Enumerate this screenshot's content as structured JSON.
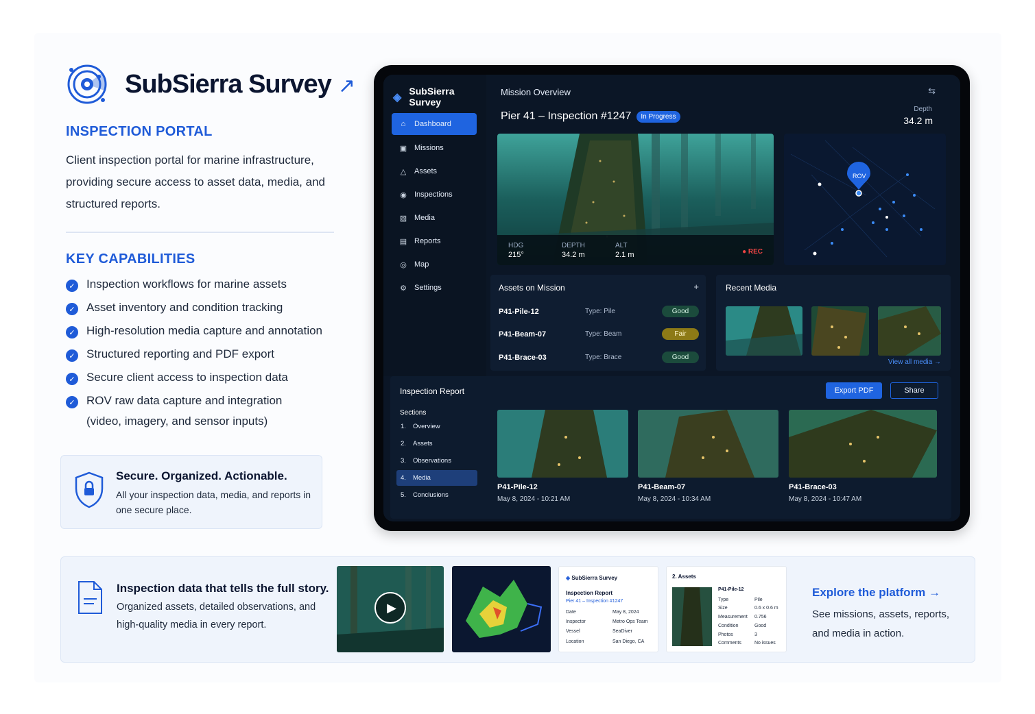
{
  "brand": {
    "name": "SubSierra Survey",
    "arrow": "↗"
  },
  "portal": {
    "heading": "INSPECTION PORTAL",
    "description": "Client inspection portal for marine infrastructure, providing secure access to asset data, media, and structured reports."
  },
  "capabilities": {
    "heading": "KEY CAPABILITIES",
    "items": [
      "Inspection workflows for marine assets",
      "Asset inventory and condition tracking",
      "High-resolution media capture and annotation",
      "Structured reporting and PDF export",
      "Secure client access to inspection data",
      "ROV raw data capture and integration"
    ],
    "last_sub": "(video, imagery, and sensor inputs)"
  },
  "secure_box": {
    "title": "Secure. Organized. Actionable.",
    "desc": "All your inspection data, media, and reports in one secure place."
  },
  "app": {
    "brand": "SubSierra Survey",
    "nav": [
      {
        "label": "Dashboard",
        "icon": "home-icon",
        "glyph": "⌂"
      },
      {
        "label": "Missions",
        "icon": "missions-icon",
        "glyph": "▣"
      },
      {
        "label": "Assets",
        "icon": "assets-icon",
        "glyph": "△"
      },
      {
        "label": "Inspections",
        "icon": "inspections-icon",
        "glyph": "◉"
      },
      {
        "label": "Media",
        "icon": "media-icon",
        "glyph": "▨"
      },
      {
        "label": "Reports",
        "icon": "reports-icon",
        "glyph": "▤"
      },
      {
        "label": "Map",
        "icon": "map-pin-icon",
        "glyph": "◎"
      },
      {
        "label": "Settings",
        "icon": "gear-icon",
        "glyph": "⚙"
      }
    ],
    "top_title": "Mission Overview",
    "mission_title": "Pier 41 – Inspection #1247",
    "status": "In Progress",
    "depth_label": "Depth",
    "depth_value": "34.2 m",
    "telemetry": [
      {
        "k": "HDG",
        "v": "215°"
      },
      {
        "k": "DEPTH",
        "v": "34.2 m"
      },
      {
        "k": "ALT",
        "v": "2.1 m"
      }
    ],
    "rec": "● REC",
    "rov_label": "ROV",
    "assets_panel": {
      "title": "Assets on Mission",
      "add": "+",
      "rows": [
        {
          "name": "P41-Pile-12",
          "type": "Type: Pile",
          "status": "Good"
        },
        {
          "name": "P41-Beam-07",
          "type": "Type: Beam",
          "status": "Fair"
        },
        {
          "name": "P41-Brace-03",
          "type": "Type: Brace",
          "status": "Good"
        }
      ]
    },
    "recent_media": {
      "title": "Recent Media",
      "view_all": "View all media →"
    },
    "report": {
      "title": "Inspection Report",
      "export": "Export PDF",
      "share": "Share",
      "sections_label": "Sections",
      "sections": [
        {
          "num": "1.",
          "label": "Overview"
        },
        {
          "num": "2.",
          "label": "Assets"
        },
        {
          "num": "3.",
          "label": "Observations"
        },
        {
          "num": "4.",
          "label": "Media"
        },
        {
          "num": "5.",
          "label": "Conclusions"
        }
      ],
      "media": [
        {
          "name": "P41-Pile-12",
          "date": "May 8, 2024 - 10:21 AM"
        },
        {
          "name": "P41-Beam-07",
          "date": "May 8, 2024 - 10:34 AM"
        },
        {
          "name": "P41-Brace-03",
          "date": "May 8, 2024 - 10:47 AM"
        }
      ]
    }
  },
  "bottom": {
    "title": "Inspection data that tells the full story.",
    "desc": "Organized assets, detailed observations, and high-quality media in every report.",
    "report_card": {
      "brand": "SubSierra Survey",
      "title": "Inspection Report",
      "subtitle": "Pier 41 – Inspection #1247",
      "rows": [
        {
          "l": "Date",
          "v": "May 8, 2024"
        },
        {
          "l": "Inspector",
          "v": "Metro Ops Team"
        },
        {
          "l": "Vessel",
          "v": "SeaDiver"
        },
        {
          "l": "Location",
          "v": "San Diego, CA"
        }
      ]
    },
    "assets_card": {
      "title": "2. Assets",
      "asset": "P41-Pile-12",
      "rows": [
        {
          "l": "Type",
          "v": "Pile"
        },
        {
          "l": "Size",
          "v": "0.6 x 0.6 m"
        },
        {
          "l": "Measurement",
          "v": "0.756"
        },
        {
          "l": "Condition",
          "v": "Good"
        },
        {
          "l": "Photos",
          "v": "3"
        },
        {
          "l": "Comments",
          "v": "No issues"
        }
      ]
    },
    "explore": "Explore the platform →",
    "explore_desc": "See missions, assets, reports, and media in action."
  }
}
